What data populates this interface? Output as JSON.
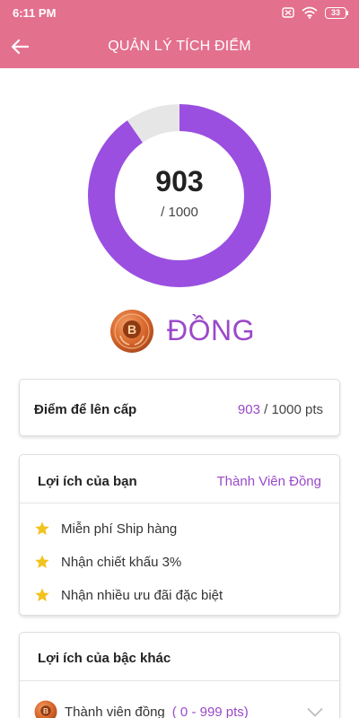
{
  "status_bar": {
    "time": "6:11 PM",
    "battery": "33",
    "icons": [
      "sim-off-icon",
      "wifi-icon",
      "battery-icon"
    ]
  },
  "header": {
    "title": "QUẢN LÝ TÍCH ĐIỂM",
    "back_icon": "arrow-left-icon",
    "background_color": "#e3708d"
  },
  "progress": {
    "current": "903",
    "total_label": "/ 1000",
    "fraction": 0.903,
    "fill_color": "#9a4fe0",
    "track_color": "#e6e6e6"
  },
  "tier": {
    "name": "ĐỒNG",
    "badge_letter": "B",
    "color": "#9a49c8"
  },
  "points_card": {
    "label": "Điểm để lên cấp",
    "current": "903",
    "rest": " / 1000 pts"
  },
  "benefits_card": {
    "title": "Lợi ích của bạn",
    "tier_label": "Thành Viên Đồng",
    "items": [
      "Miễn phí Ship hàng",
      "Nhận chiết khấu 3%",
      "Nhận nhiều ưu đãi đặc biệt"
    ]
  },
  "other_tiers_card": {
    "title": "Lợi ích của bậc khác",
    "items": [
      {
        "name": "Thành viên đồng",
        "range": " ( 0 - 999 pts)"
      }
    ]
  }
}
